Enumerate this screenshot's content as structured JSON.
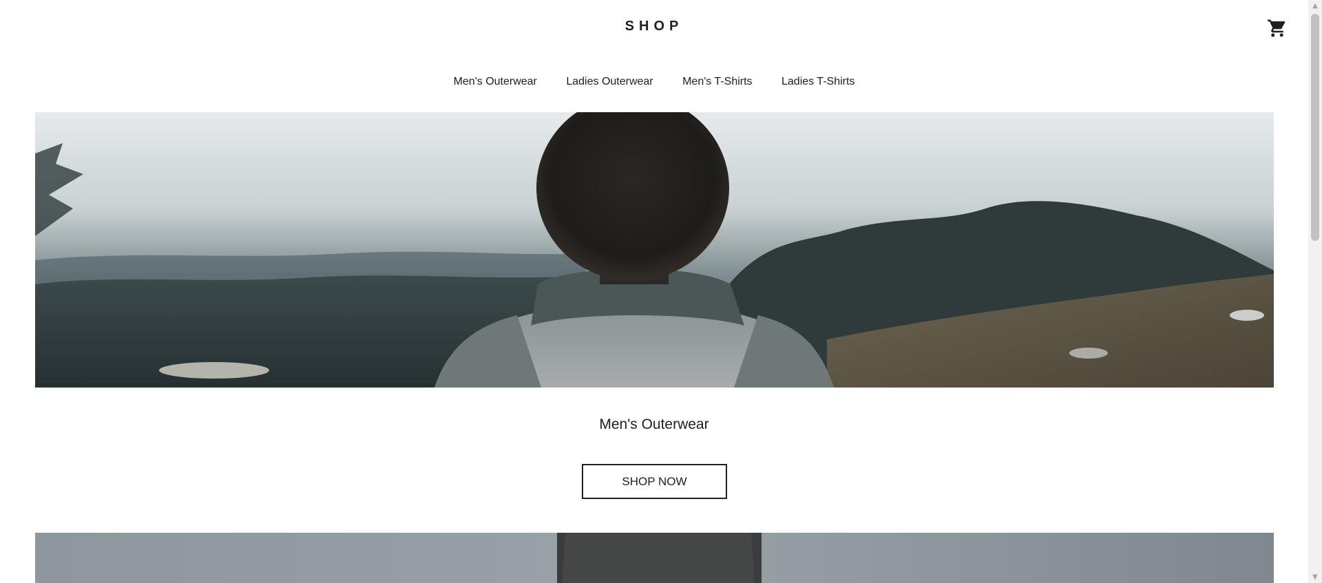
{
  "header": {
    "logo": "SHOP",
    "cart_icon": "shopping-cart-icon"
  },
  "nav": {
    "items": [
      {
        "label": "Men's Outerwear"
      },
      {
        "label": "Ladies Outerwear"
      },
      {
        "label": "Men's T-Shirts"
      },
      {
        "label": "Ladies T-Shirts"
      }
    ]
  },
  "hero": {
    "category_title": "Men's Outerwear",
    "button_label": "SHOP NOW"
  },
  "scrollbar": {
    "up_icon": "arrow-up-icon",
    "down_icon": "arrow-down-icon"
  }
}
